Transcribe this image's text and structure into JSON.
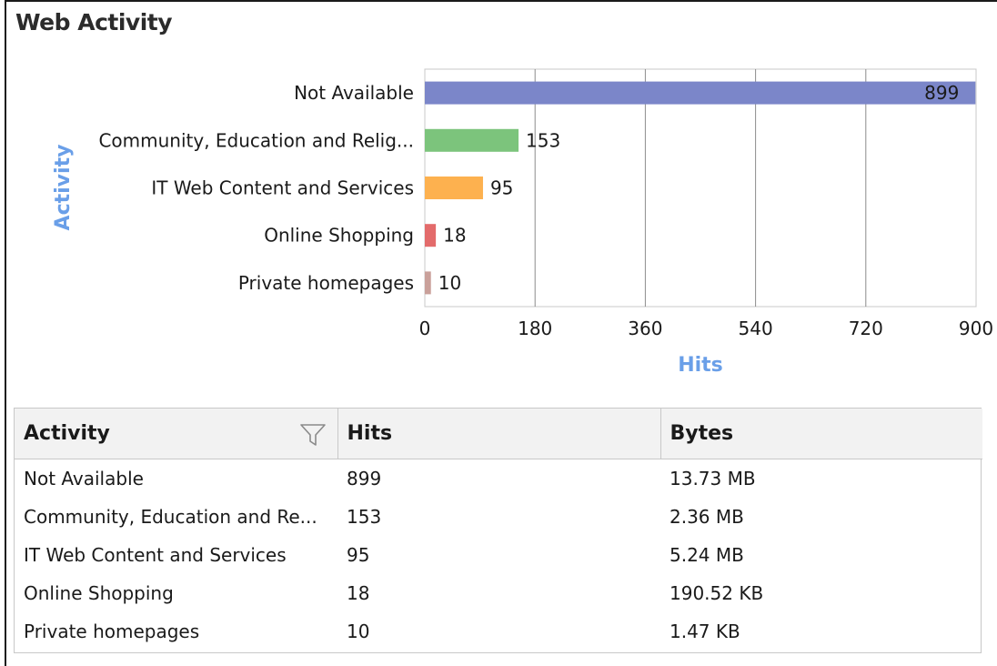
{
  "title": "Web Activity",
  "chart_data": {
    "type": "bar",
    "orientation": "horizontal",
    "categories": [
      "Not Available",
      "Community, Education and Relig...",
      "IT Web Content and Services",
      "Online Shopping",
      "Private homepages"
    ],
    "values": [
      899,
      153,
      95,
      18,
      10
    ],
    "colors": [
      "#7b86c9",
      "#7cc47c",
      "#fdb14f",
      "#e36b6b",
      "#c9a09a"
    ],
    "xlabel": "Hits",
    "ylabel": "Activity",
    "xlim": [
      0,
      900
    ],
    "xticks": [
      "0",
      "180",
      "360",
      "540",
      "720",
      "900"
    ],
    "grid": true
  },
  "table": {
    "headers": [
      "Activity",
      "Hits",
      "Bytes"
    ],
    "filter_icon": "funnel-icon",
    "rows": [
      [
        "Not Available",
        "899",
        "13.73 MB"
      ],
      [
        "Community, Education and Re...",
        "153",
        "2.36 MB"
      ],
      [
        "IT Web Content and Services",
        "95",
        "5.24 MB"
      ],
      [
        "Online Shopping",
        "18",
        "190.52 KB"
      ],
      [
        "Private homepages",
        "10",
        "1.47 KB"
      ]
    ]
  }
}
